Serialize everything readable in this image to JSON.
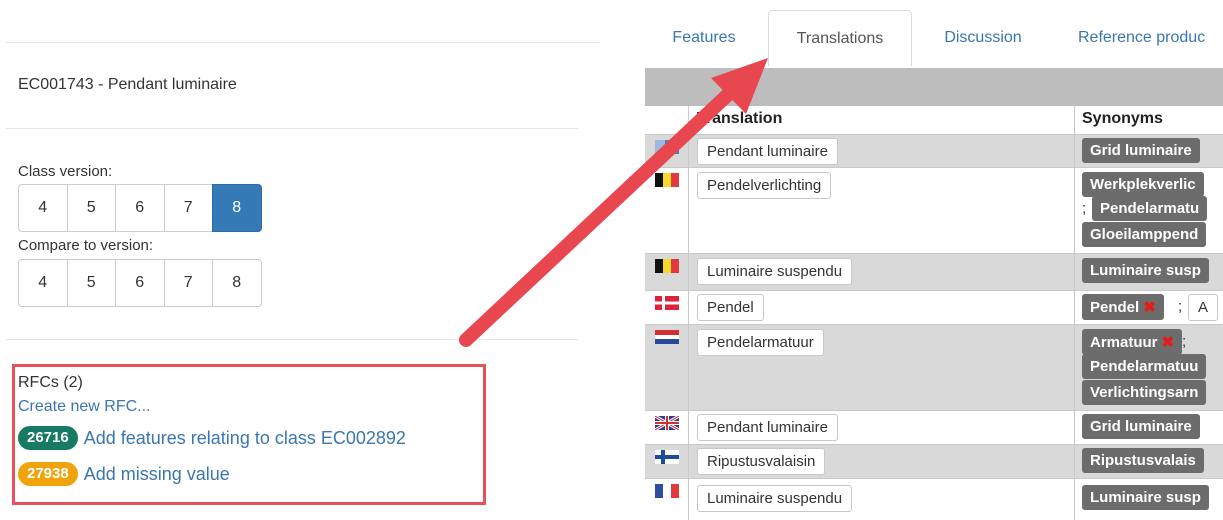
{
  "classification": {
    "title": "EC001743 - Pendant luminaire",
    "class_version_label": "Class version:",
    "class_versions": [
      "4",
      "5",
      "6",
      "7",
      "8"
    ],
    "class_version_selected": "8",
    "compare_label": "Compare to version:",
    "compare_versions": [
      "4",
      "5",
      "6",
      "7",
      "8"
    ]
  },
  "rfcs": {
    "title": "RFCs (2)",
    "create_label": "Create new RFC...",
    "items": [
      {
        "id": "26716",
        "label": "Add features relating to class EC002892",
        "badge_color": "#177a63"
      },
      {
        "id": "27938",
        "label": "Add missing value",
        "badge_color": "#f0a30a"
      }
    ]
  },
  "tabs": [
    "Features",
    "Translations",
    "Discussion",
    "Reference produc"
  ],
  "active_tab": "Translations",
  "table": {
    "col_translation": "Translation",
    "col_synonyms": "Synonyms",
    "rows": [
      {
        "flag": "flag-unknown-icon",
        "translation": "Pendant luminaire",
        "synonyms": [
          "Grid luminaire"
        ]
      },
      {
        "flag": "flag-belgium-icon",
        "translation": "Pendelverlichting",
        "synonyms": [
          "Werkplekverlic",
          "Pendelarmatu",
          "Gloeilamppend"
        ]
      },
      {
        "flag": "flag-belgium-icon",
        "translation": "Luminaire suspendu",
        "synonyms": [
          "Luminaire susp"
        ]
      },
      {
        "flag": "flag-denmark-icon",
        "translation": "Pendel",
        "synonyms": [
          "Pendel",
          "A"
        ]
      },
      {
        "flag": "flag-netherlands-icon",
        "translation": "Pendelarmatuur",
        "synonyms": [
          "Armatuur",
          "Pendelarmatuu",
          "Verlichtingsarn"
        ]
      },
      {
        "flag": "flag-uk-icon",
        "translation": "Pendant luminaire",
        "synonyms": [
          "Grid luminaire"
        ]
      },
      {
        "flag": "flag-finland-icon",
        "translation": "Ripustusvalaisin",
        "synonyms": [
          "Ripustusvalais"
        ]
      },
      {
        "flag": "flag-france-icon",
        "translation": "Luminaire suspendu",
        "synonyms": [
          "Luminaire susp"
        ]
      }
    ]
  },
  "colors": {
    "accent": "#337ab7",
    "highlight_box": "#e8515a",
    "arrow": "#e8474f"
  }
}
